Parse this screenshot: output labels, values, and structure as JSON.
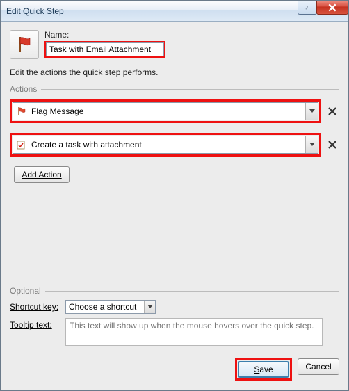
{
  "title": "Edit Quick Step",
  "name": {
    "label": "Name:",
    "value": "Task with Email Attachment"
  },
  "instruction": "Edit the actions the quick step performs.",
  "actions_group_label": "Actions",
  "actions": [
    {
      "label": "Flag Message"
    },
    {
      "label": "Create a task with attachment"
    }
  ],
  "add_action_label": "Add Action",
  "optional_group_label": "Optional",
  "shortcut": {
    "label_prefix": "Shortcut ",
    "label_u": "k",
    "label_suffix": "ey:",
    "value": "Choose a shortcut"
  },
  "tooltip": {
    "label_u": "T",
    "label_suffix": "ooltip text:",
    "placeholder": "This text will show up when the mouse hovers over the quick step."
  },
  "buttons": {
    "save_u": "S",
    "save_suffix": "ave",
    "cancel": "Cancel"
  }
}
